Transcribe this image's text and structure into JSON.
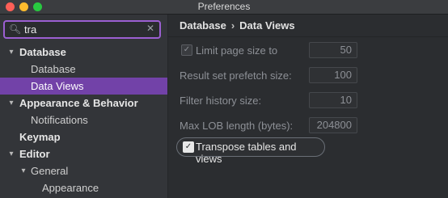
{
  "window": {
    "title": "Preferences"
  },
  "search": {
    "value": "tra",
    "icon": "search-icon",
    "clear_icon": "clear-icon"
  },
  "sidebar": {
    "items": [
      {
        "label": "Database",
        "bold": true,
        "arrow": "▾"
      },
      {
        "label": "Database",
        "bold": false
      },
      {
        "label": "Data Views",
        "bold": false,
        "selected": true
      },
      {
        "label": "Appearance & Behavior",
        "bold": true,
        "arrow": "▾"
      },
      {
        "label": "Notifications",
        "bold": false
      },
      {
        "label": "Keymap",
        "bold": true
      },
      {
        "label": "Editor",
        "bold": true,
        "arrow": "▾"
      },
      {
        "label": "General",
        "bold": false,
        "arrow": "▾"
      },
      {
        "label": "Appearance",
        "bold": false
      }
    ]
  },
  "content": {
    "breadcrumb": {
      "parent": "Database",
      "separator": "›",
      "current": "Data Views"
    },
    "settings": {
      "limit_page_size": {
        "label": "Limit page size to",
        "value": "50",
        "checked": true,
        "enabled": false
      },
      "prefetch": {
        "label": "Result set prefetch size:",
        "value": "100"
      },
      "filter_history": {
        "label": "Filter history size:",
        "value": "10"
      },
      "max_lob": {
        "label": "Max LOB length (bytes):",
        "value": "204800"
      },
      "transpose": {
        "label": "Transpose tables and views",
        "checked": true
      }
    }
  },
  "colors": {
    "accent": "#7242a8",
    "search_focus": "#9b5fd1"
  }
}
